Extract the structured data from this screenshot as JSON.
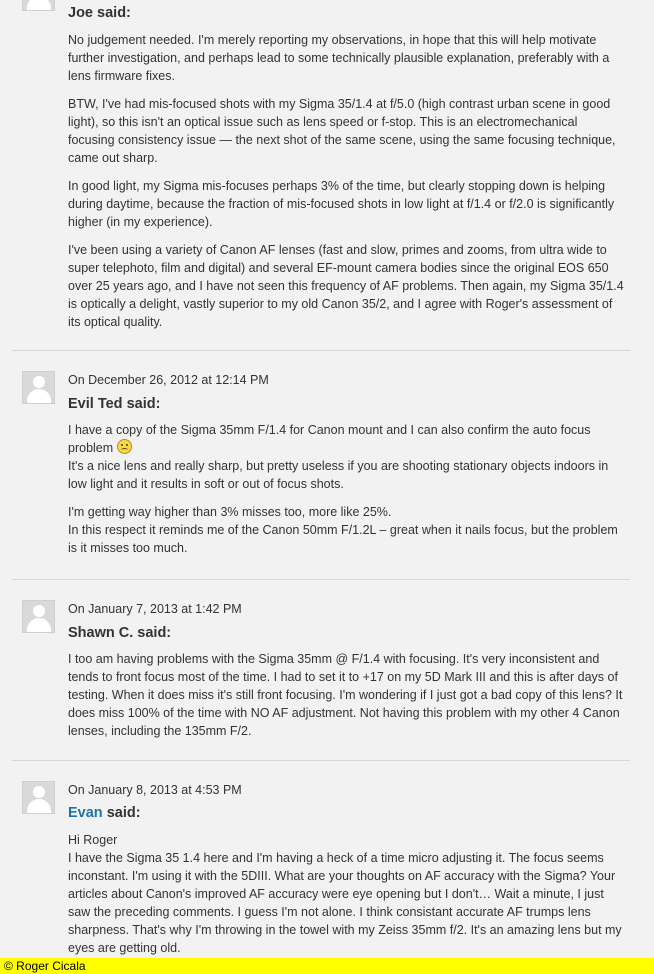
{
  "comments": [
    {
      "author": "Joe",
      "said": "said:",
      "paragraphs": [
        "No judgement needed. I'm merely reporting my observations, in hope that this will help motivate further investigation, and perhaps lead to some technically plausible explanation, preferably with a lens firmware fixes.",
        "BTW, I've had mis-focused shots with my Sigma 35/1.4 at f/5.0 (high contrast urban scene in good light), so this isn't an optical issue such as lens speed or f-stop. This is an electromechanical focusing consistency issue — the next shot of the same scene, using the same focusing technique, came out sharp.",
        "In good light, my Sigma mis-focuses perhaps 3% of the time, but clearly stopping down is helping during daytime, because the fraction of mis-focused shots in low light at f/1.4 or f/2.0 is significantly higher (in my experience).",
        "I've been using a variety of Canon AF lenses (fast and slow, primes and zooms, from ultra wide to super telephoto, film and digital) and several EF-mount camera bodies since the original EOS 650 over 25 years ago, and I have not seen this frequency of AF problems. Then again, my Sigma 35/1.4 is optically a delight, vastly superior to my old Canon 35/2, and I agree with Roger's assessment of its optical quality."
      ]
    },
    {
      "date": "On December 26, 2012 at 12:14 PM",
      "author": "Evil Ted",
      "said": "said:",
      "p1": "I have a copy of the Sigma 35mm F/1.4 for Canon mount and I can also confirm the auto focus problem",
      "p2": "It's a nice lens and really sharp, but pretty useless if you are shooting stationary objects indoors in low light and it results in soft or out of focus shots.",
      "p3a": "I'm getting way higher than 3% misses too, more like 25%.",
      "p3b": "In this respect it reminds me of the Canon 50mm F/1.2L – great when it nails focus, but the problem is it misses too much."
    },
    {
      "date": "On January 7, 2013 at 1:42 PM",
      "author": "Shawn C.",
      "said": "said:",
      "p1": "I too am having problems with the Sigma 35mm @ F/1.4 with focusing. It's very inconsistent and tends to front focus most of the time. I had to set it to +17 on my 5D Mark III and this is after days of testing. When it does miss it's still front focusing. I'm wondering if I just got a bad copy of this lens? It does miss 100% of the time with NO AF adjustment. Not having this problem with my other 4 Canon lenses, including the 135mm F/2."
    },
    {
      "date": "On January 8, 2013 at 4:53 PM",
      "author": "Evan",
      "said": "said:",
      "greeting": "Hi Roger",
      "p1": "I have the Sigma 35 1.4 here and I'm having a heck of a time micro adjusting it. The focus seems inconstant. I'm using it with the 5DIII. What are your thoughts on AF accuracy with the Sigma? Your articles about Canon's improved AF accuracy were eye opening but I don't… Wait a minute, I just saw the preceding comments. I guess I'm not alone. I think consistant accurate AF trumps lens sharpness. That's why I'm throwing in the towel with my Zeiss 35mm f/2. It's an amazing lens but my eyes are getting old."
    }
  ],
  "footer": "© Roger Cicala",
  "colors": {
    "author_link": "#1e73a8",
    "footer_bg": "#ffff00"
  }
}
